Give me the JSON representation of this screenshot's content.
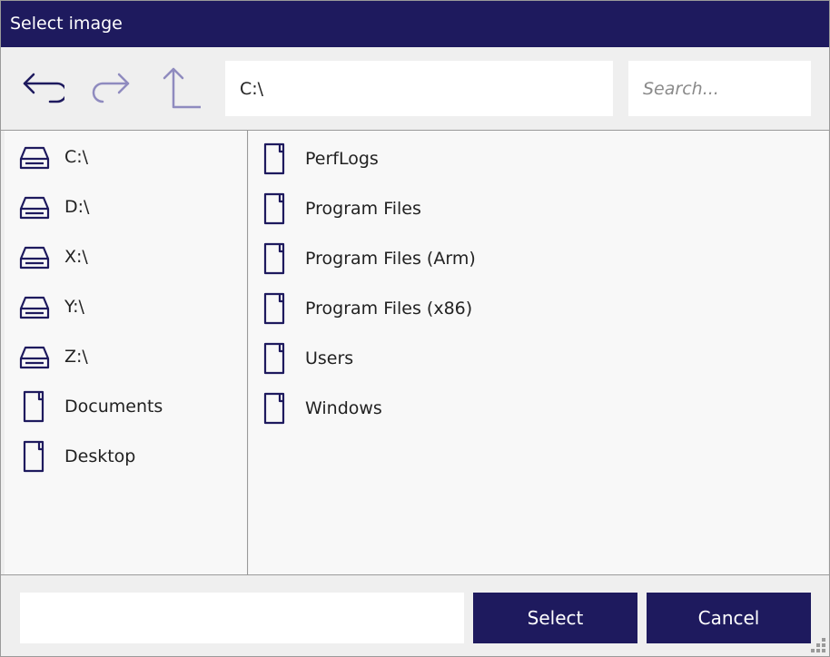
{
  "window": {
    "title": "Select image"
  },
  "toolbar": {
    "back_icon": "back-arrow-icon",
    "forward_icon": "forward-arrow-icon",
    "up_icon": "up-arrow-icon",
    "address_value": "C:\\",
    "search_placeholder": "Search..."
  },
  "sidebar": {
    "items": [
      {
        "label": "C:\\",
        "icon": "drive-icon"
      },
      {
        "label": "D:\\",
        "icon": "drive-icon"
      },
      {
        "label": "X:\\",
        "icon": "drive-icon"
      },
      {
        "label": "Y:\\",
        "icon": "drive-icon"
      },
      {
        "label": "Z:\\",
        "icon": "drive-icon"
      },
      {
        "label": "Documents",
        "icon": "file-icon"
      },
      {
        "label": "Desktop",
        "icon": "file-icon"
      }
    ]
  },
  "files": {
    "items": [
      {
        "label": "PerfLogs",
        "icon": "file-icon"
      },
      {
        "label": "Program Files",
        "icon": "file-icon"
      },
      {
        "label": "Program Files (Arm)",
        "icon": "file-icon"
      },
      {
        "label": "Program Files (x86)",
        "icon": "file-icon"
      },
      {
        "label": "Users",
        "icon": "file-icon"
      },
      {
        "label": "Windows",
        "icon": "file-icon"
      }
    ]
  },
  "footer": {
    "filename_value": "",
    "select_label": "Select",
    "cancel_label": "Cancel"
  },
  "colors": {
    "accent": "#1e1a5e",
    "icon_dark": "#1e1a5e",
    "icon_disabled": "#8f8bbf"
  }
}
